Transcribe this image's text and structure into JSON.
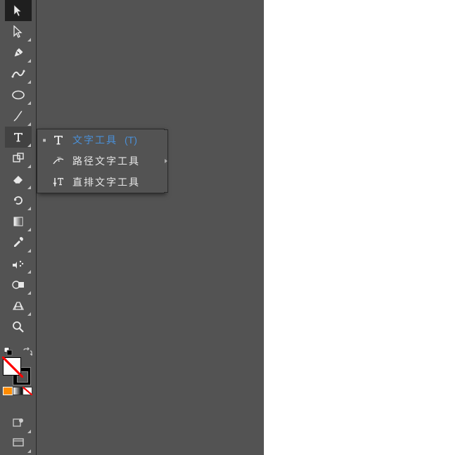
{
  "tools": [
    {
      "name": "selection-tool",
      "selected": true,
      "tri": false
    },
    {
      "name": "direct-selection-tool",
      "selected": false,
      "tri": true
    },
    {
      "name": "pen-tool",
      "selected": false,
      "tri": true
    },
    {
      "name": "curvature-tool",
      "selected": false,
      "tri": true
    },
    {
      "name": "ellipse-tool",
      "selected": false,
      "tri": true
    },
    {
      "name": "paintbrush-tool",
      "selected": false,
      "tri": true
    },
    {
      "name": "type-tool",
      "selected": false,
      "tri": true,
      "active": true
    },
    {
      "name": "artboard-tool",
      "selected": false,
      "tri": true
    },
    {
      "name": "eraser-tool",
      "selected": false,
      "tri": true
    },
    {
      "name": "rotate-tool",
      "selected": false,
      "tri": true
    },
    {
      "name": "gradient-tool",
      "selected": false,
      "tri": true
    },
    {
      "name": "eyedropper-tool",
      "selected": false,
      "tri": true
    },
    {
      "name": "symbol-sprayer-tool",
      "selected": false,
      "tri": true
    },
    {
      "name": "shape-builder-tool",
      "selected": false,
      "tri": true
    },
    {
      "name": "perspective-grid-tool",
      "selected": false,
      "tri": true
    },
    {
      "name": "zoom-tool",
      "selected": false,
      "tri": false
    }
  ],
  "flyout": {
    "items": [
      {
        "label": "文字工具",
        "shortcut": "(T)",
        "highlighted": true,
        "icon": "type-icon",
        "marker": "■"
      },
      {
        "label": "路径文字工具",
        "shortcut": "",
        "highlighted": false,
        "icon": "type-on-path-icon",
        "marker": ""
      },
      {
        "label": "直排文字工具",
        "shortcut": "",
        "highlighted": false,
        "icon": "vertical-type-icon",
        "marker": ""
      }
    ]
  },
  "colors": {
    "fill": "none",
    "stroke": "#000000"
  },
  "draw_modes": [
    "solid",
    "gradient",
    "none"
  ]
}
